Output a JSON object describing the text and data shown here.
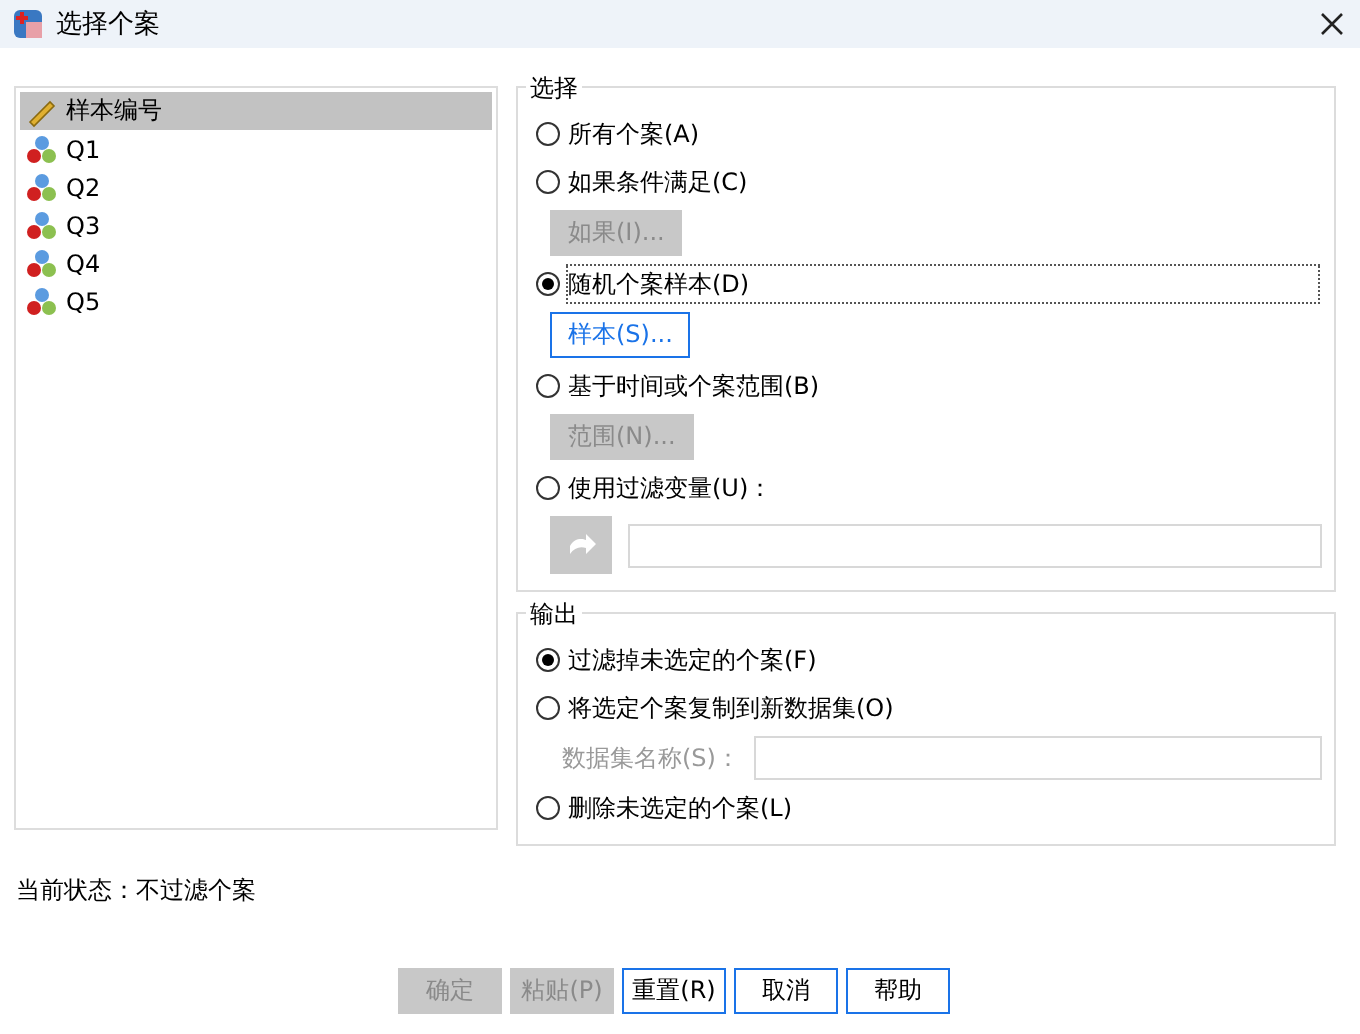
{
  "window": {
    "title": "选择个案"
  },
  "variables": [
    {
      "name": "样本编号",
      "kind": "scale",
      "selected": true
    },
    {
      "name": "Q1",
      "kind": "nominal",
      "selected": false
    },
    {
      "name": "Q2",
      "kind": "nominal",
      "selected": false
    },
    {
      "name": "Q3",
      "kind": "nominal",
      "selected": false
    },
    {
      "name": "Q4",
      "kind": "nominal",
      "selected": false
    },
    {
      "name": "Q5",
      "kind": "nominal",
      "selected": false
    }
  ],
  "select_group": {
    "title": "选择",
    "items": [
      {
        "kind": "radio",
        "label": "所有个案(A)",
        "selected": false,
        "focused": false
      },
      {
        "kind": "radio",
        "label": "如果条件满足(C)",
        "selected": false,
        "focused": false
      },
      {
        "kind": "button",
        "label": "如果(I)...",
        "disabled": true
      },
      {
        "kind": "radio",
        "label": "随机个案样本(D)",
        "selected": true,
        "focused": true
      },
      {
        "kind": "button",
        "label": "样本(S)...",
        "disabled": false
      },
      {
        "kind": "radio",
        "label": "基于时间或个案范围(B)",
        "selected": false,
        "focused": false
      },
      {
        "kind": "button",
        "label": "范围(N)...",
        "disabled": true
      },
      {
        "kind": "radio",
        "label": "使用过滤变量(U)：",
        "selected": false,
        "focused": false
      },
      {
        "kind": "move_field",
        "disabled": true
      }
    ]
  },
  "output_group": {
    "title": "输出",
    "items": [
      {
        "kind": "radio",
        "label": "过滤掉未选定的个案(F)",
        "selected": true,
        "focused": false
      },
      {
        "kind": "radio",
        "label": "将选定个案复制到新数据集(O)",
        "selected": false,
        "focused": false
      },
      {
        "kind": "labeled_field",
        "label": "数据集名称(S)：",
        "disabled": true
      },
      {
        "kind": "radio",
        "label": "删除未选定的个案(L)",
        "selected": false,
        "focused": false
      }
    ]
  },
  "status": "当前状态：不过滤个案",
  "buttons": [
    {
      "label": "确定",
      "disabled": true
    },
    {
      "label": "粘贴(P)",
      "disabled": true
    },
    {
      "label": "重置(R)",
      "disabled": false
    },
    {
      "label": "取消",
      "disabled": false
    },
    {
      "label": "帮助",
      "disabled": false
    }
  ]
}
